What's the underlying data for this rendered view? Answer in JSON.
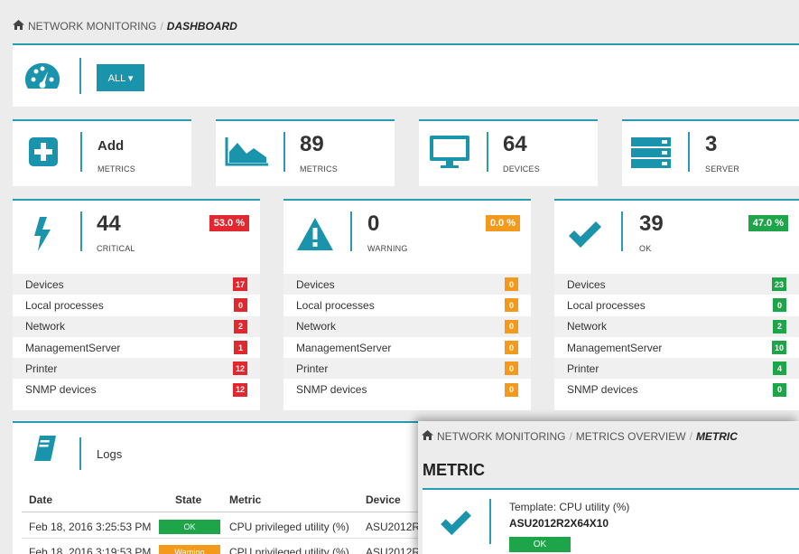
{
  "colors": {
    "accent": "#2a9bb3",
    "critical": "#e0282e",
    "warning": "#f39a1c",
    "ok": "#1ea449"
  },
  "breadcrumb": {
    "home_icon": "home-icon",
    "root": "NETWORK MONITORING",
    "sep": "/",
    "current": "DASHBOARD"
  },
  "toolbar": {
    "gauge_icon": "gauge-icon",
    "filter_label": "ALL ▾"
  },
  "summary": [
    {
      "icon": "plus-square-icon",
      "title": "Add",
      "label": "METRICS"
    },
    {
      "icon": "area-chart-icon",
      "value": "89",
      "label": "METRICS"
    },
    {
      "icon": "monitor-icon",
      "value": "64",
      "label": "DEVICES"
    },
    {
      "icon": "server-icon",
      "value": "3",
      "label": "SERVER"
    }
  ],
  "status": [
    {
      "icon": "bolt-icon",
      "value": "44",
      "label": "CRITICAL",
      "percent": "53.0 %",
      "rows": [
        {
          "name": "Devices",
          "count": "17"
        },
        {
          "name": "Local processes",
          "count": "0"
        },
        {
          "name": "Network",
          "count": "2"
        },
        {
          "name": "ManagementServer",
          "count": "1"
        },
        {
          "name": "Printer",
          "count": "12"
        },
        {
          "name": "SNMP devices",
          "count": "12"
        }
      ]
    },
    {
      "icon": "warning-icon",
      "value": "0",
      "label": "WARNING",
      "percent": "0.0 %",
      "rows": [
        {
          "name": "Devices",
          "count": "0"
        },
        {
          "name": "Local processes",
          "count": "0"
        },
        {
          "name": "Network",
          "count": "0"
        },
        {
          "name": "ManagementServer",
          "count": "0"
        },
        {
          "name": "Printer",
          "count": "0"
        },
        {
          "name": "SNMP devices",
          "count": "0"
        }
      ]
    },
    {
      "icon": "check-icon",
      "value": "39",
      "label": "OK",
      "percent": "47.0 %",
      "rows": [
        {
          "name": "Devices",
          "count": "23"
        },
        {
          "name": "Local processes",
          "count": "0"
        },
        {
          "name": "Network",
          "count": "2"
        },
        {
          "name": "ManagementServer",
          "count": "10"
        },
        {
          "name": "Printer",
          "count": "4"
        },
        {
          "name": "SNMP devices",
          "count": "0"
        }
      ]
    }
  ],
  "logs": {
    "icon": "book-icon",
    "title": "Logs",
    "columns": [
      "Date",
      "State",
      "Metric",
      "Device"
    ],
    "rows": [
      {
        "date": "Feb 18, 2016 3:25:53 PM",
        "state": "OK",
        "metric": "CPU privileged utility (%)",
        "device": "ASU2012R"
      },
      {
        "date": "Feb 18, 2016 3:19:53 PM",
        "state": "Warning",
        "metric": "CPU privileged utility (%)",
        "device": "ASU2012R"
      }
    ]
  },
  "overlay": {
    "breadcrumb": {
      "home_icon": "home-icon",
      "root": "NETWORK MONITORING",
      "mid": "METRICS OVERVIEW",
      "current": "METRIC"
    },
    "title": "METRIC",
    "template_label": "Template:",
    "template_value": "CPU utility (%)",
    "host": "ASU2012R2X64X10",
    "state": "OK",
    "icon": "check-icon"
  }
}
